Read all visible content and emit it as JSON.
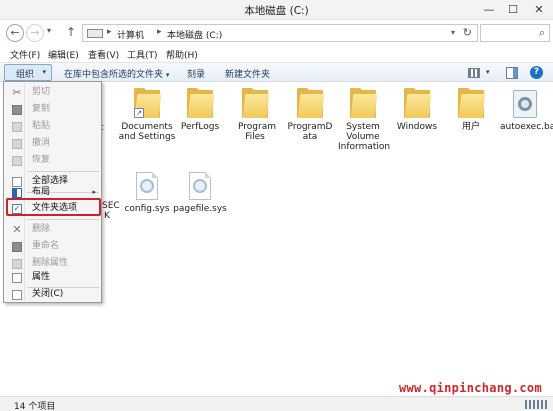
{
  "window": {
    "title": "本地磁盘 (C:)",
    "minimize": "—",
    "maximize": "☐",
    "close": "✕"
  },
  "address": {
    "back_glyph": "←",
    "forward_glyph": "→",
    "recent_glyph": "▾",
    "up_glyph": "↑",
    "crumbs": [
      "计算机",
      "本地磁盘 (C:)"
    ],
    "separator": "▸",
    "dropdown_glyph": "▾",
    "refresh_glyph": "↻",
    "search_glyph": "⌕"
  },
  "menubar": [
    "文件(F)",
    "编辑(E)",
    "查看(V)",
    "工具(T)",
    "帮助(H)"
  ],
  "commandbar": {
    "organize": "组织",
    "organize_arrow": "▾",
    "include_in_library": "在库中包含所选的文件夹",
    "include_arrow": "▾",
    "burn": "刻录",
    "new_folder": "新建文件夹",
    "view_dropdown": "▾",
    "help": "?"
  },
  "organize_menu": {
    "cut": "剪切",
    "copy": "复制",
    "paste": "粘贴",
    "undo": "撤消",
    "redo": "恢复",
    "select_all": "全部选择",
    "layout": "布局",
    "submenu_arrow": "▸",
    "folder_options": "文件夹选项",
    "check_glyph": "✓",
    "delete": "删除",
    "cross_glyph": "✕",
    "rename": "重命名",
    "remove_properties": "删除属性",
    "properties": "属性",
    "close": "关闭(C)"
  },
  "items": [
    {
      "label": "Documents and Settings",
      "icon": "folder-shortcut-icon",
      "shortcut_glyph": "↗"
    },
    {
      "label": "PerfLogs",
      "icon": "folder-icon"
    },
    {
      "label": "Program Files",
      "icon": "folder-icon"
    },
    {
      "label": "ProgramData",
      "icon": "folder-icon"
    },
    {
      "label": "System Volume Information",
      "icon": "folder-icon"
    },
    {
      "label": "Windows",
      "icon": "folder-icon"
    },
    {
      "label": "用户",
      "icon": "folder-icon"
    },
    {
      "label": "autoexec.bat",
      "icon": "batch-file-icon"
    },
    {
      "label": "config.sys",
      "icon": "system-file-icon"
    },
    {
      "label": "pagefile.sys",
      "icon": "system-file-icon"
    }
  ],
  "partial_labels": {
    "row1": "t",
    "row2a": "SEC",
    "row2b": "K"
  },
  "status": {
    "count": "14 个项目"
  },
  "watermark": "www.qinpinchang.com"
}
